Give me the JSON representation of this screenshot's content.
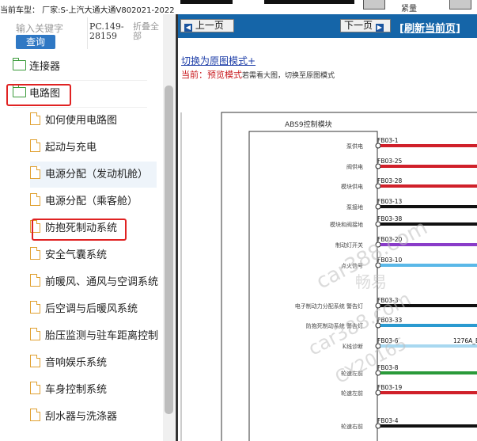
{
  "top_bar": {
    "vehicle_info": "当前车型：  厂家:S-上汽大通大通V802021-2022",
    "button_label": "紧量"
  },
  "search": {
    "placeholder": "输入关键字",
    "button_label": "查询",
    "part_number": "PC.149-28159",
    "collapse_label": "折叠全部"
  },
  "tree": {
    "items": [
      {
        "label": "连接器",
        "level": 1,
        "icon": "folder-icon"
      },
      {
        "label": "电路图",
        "level": 1,
        "icon": "folder-open-icon",
        "highlighted": true
      },
      {
        "label": "如何使用电路图",
        "level": 2,
        "icon": "document-icon"
      },
      {
        "label": "起动与充电",
        "level": 2,
        "icon": "document-icon"
      },
      {
        "label": "电源分配（发动机舱）",
        "level": 2,
        "icon": "document-icon",
        "selected": true
      },
      {
        "label": "电源分配（乘客舱）",
        "level": 2,
        "icon": "document-icon"
      },
      {
        "label": "防抱死制动系统",
        "level": 2,
        "icon": "document-icon",
        "highlighted": true
      },
      {
        "label": "安全气囊系统",
        "level": 2,
        "icon": "document-icon"
      },
      {
        "label": "前暖风、通风与空调系统",
        "level": 2,
        "icon": "document-icon"
      },
      {
        "label": "后空调与后暖风系统",
        "level": 2,
        "icon": "document-icon"
      },
      {
        "label": "胎压监测与驻车距离控制",
        "level": 2,
        "icon": "document-icon"
      },
      {
        "label": "音响娱乐系统",
        "level": 2,
        "icon": "document-icon"
      },
      {
        "label": "车身控制系统",
        "level": 2,
        "icon": "document-icon"
      },
      {
        "label": "刮水器与洗涤器",
        "level": 2,
        "icon": "document-icon"
      }
    ],
    "highlight_color": "#e02222",
    "folder_color": "#3a9a3a",
    "doc_color": "#e0a030"
  },
  "nav": {
    "prev_label": "上一页",
    "next_label": "下一页",
    "refresh_label": "[刷新当前页]",
    "bar_color": "#1565a8"
  },
  "mode": {
    "switch_link": "切换为原图模式+",
    "current_prefix": "当前：",
    "current_mode": "预览模式",
    "hint": "若需看大图，切换至原图模式"
  },
  "diagram": {
    "module_title": "ABS9控制模块",
    "pins": [
      {
        "label": "泵供电",
        "code": "FB03-1",
        "color": "#d0202a"
      },
      {
        "label": "阀供电",
        "code": "FB03-25",
        "color": "#d0202a"
      },
      {
        "label": "模块供电",
        "code": "FB03-28",
        "color": "#d0202a"
      },
      {
        "label": "泵接地",
        "code": "FB03-13",
        "color": "#111111"
      },
      {
        "label": "模块和阀接地",
        "code": "FB03-38",
        "color": "#111111"
      },
      {
        "label": "制动灯开关",
        "code": "FB03-20",
        "color": "#8a3cc9"
      },
      {
        "label": "点火信号",
        "code": "FB03-10",
        "color": "#5ab8e8"
      },
      {
        "label": "电子制动力分配系统 警告灯",
        "code": "FB03-3",
        "color": "#111111"
      },
      {
        "label": "防抱死制动系统 警告灯",
        "code": "FB03-33",
        "color": "#2a9ad0"
      },
      {
        "label": "K线诊断",
        "code": "FB03-6",
        "color": "#a8d8f0",
        "extra": "1276A_E"
      },
      {
        "label": "轮速左前",
        "code": "FB03-8",
        "color": "#2a9a3a"
      },
      {
        "label": "轮速左前",
        "code": "FB03-19",
        "color": "#d0202a"
      },
      {
        "label": "轮速右前",
        "code": "FB03-4",
        "color": "#111111"
      }
    ]
  },
  "watermarks": [
    "car388.com",
    "畅易",
    "car388.com",
    "CY20165"
  ]
}
